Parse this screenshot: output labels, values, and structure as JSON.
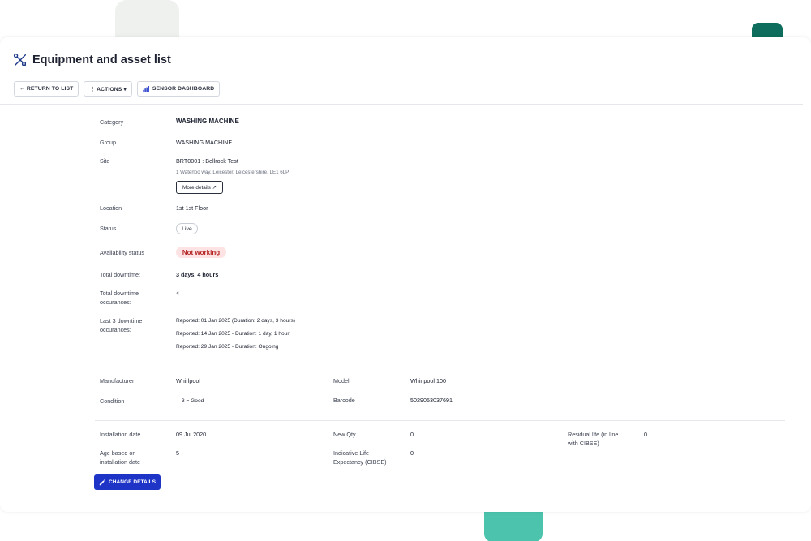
{
  "header": {
    "title": "Equipment and asset list"
  },
  "toolbar": {
    "return_label": "← RETURN TO LIST",
    "actions_label": "⋮ ACTIONS ▾",
    "sensor_label": "SENSOR DASHBOARD"
  },
  "details": {
    "category": {
      "label": "Category",
      "value": "WASHING MACHINE"
    },
    "group": {
      "label": "Group",
      "value": "WASHING MACHINE"
    },
    "site": {
      "label": "Site",
      "value": "BRT0001 : Bellrock Test",
      "address": "1 Waterloo way, Leicester, Leicestershire, LE1 6LP",
      "more_label": "More details ↗"
    },
    "location": {
      "label": "Location",
      "value": "1st 1st Floor"
    },
    "status": {
      "label": "Status",
      "value": "Live"
    },
    "availability": {
      "label": "Availability status",
      "value": "Not working"
    },
    "total_downtime": {
      "label": "Total downtime:",
      "value": "3 days, 4 hours"
    },
    "downtime_occ": {
      "label_1": "Total downtime",
      "label_2": "occurances:",
      "value": "4"
    },
    "last3": {
      "label_1": "Last 3 downtime",
      "label_2": "occurances:",
      "items": [
        "Reported: 01 Jan 2025 (Duration: 2 days, 3 hours)",
        "Reported: 14 Jan 2025 - Duration: 1 day, 1 hour",
        "Reported: 29 Jan 2025 - Duration: Ongoing"
      ]
    }
  },
  "specs": {
    "manufacturer": {
      "label": "Manufacturer",
      "value": "Whirlpool"
    },
    "model": {
      "label": "Model",
      "value": "Whirlpool 100"
    },
    "condition": {
      "label": "Condition",
      "value": "3 = Good"
    },
    "barcode": {
      "label": "Barcode",
      "value": "5029053037691"
    }
  },
  "lifecycle": {
    "installation_date": {
      "label": "Installation date",
      "value": "09 Jul 2020"
    },
    "new_qty": {
      "label": "New Qty",
      "value": "0"
    },
    "residual": {
      "label_1": "Residual life (in line",
      "label_2": "with CIBSE)",
      "value": "0"
    },
    "age": {
      "label_1": "Age based on",
      "label_2": "installation date",
      "value": "5"
    },
    "life_exp": {
      "label_1": "Indicative Life",
      "label_2": "Expectancy (CIBSE)",
      "value": "0"
    }
  },
  "change_button": {
    "label": "CHANGE DETAILS"
  }
}
